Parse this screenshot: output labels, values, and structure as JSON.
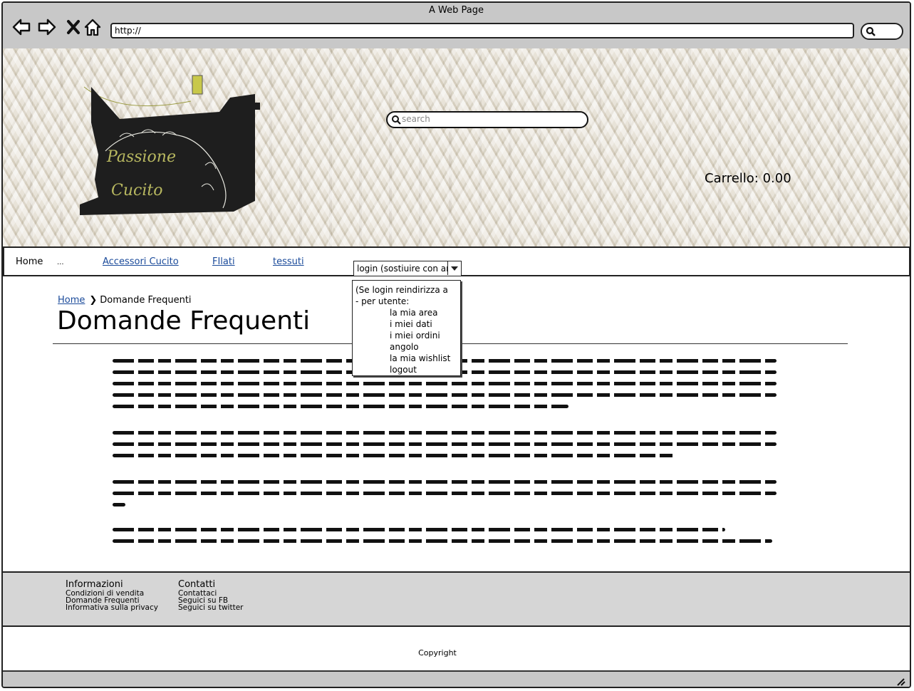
{
  "window": {
    "title": "A Web Page",
    "url": "http://"
  },
  "header": {
    "search_placeholder": "search",
    "cart_label": "Carrello: 0.00",
    "logo_text_1": "Passione",
    "logo_text_2": "Cucito"
  },
  "nav": {
    "home": "Home",
    "ellipsis": "...",
    "links": [
      "Accessori Cucito",
      "FIlati",
      "tessuti"
    ],
    "login_select": "login (sostiuire con area"
  },
  "dropdown": {
    "items": [
      "(Se login reindirizza a",
      "- per utente:",
      "la mia area",
      "i miei dati",
      "i miei ordini",
      "angolo",
      "la mia wishlist",
      "logout"
    ]
  },
  "breadcrumb": {
    "home": "Home",
    "current": "Domande Frequenti"
  },
  "page": {
    "title": "Domande Frequenti"
  },
  "footer": {
    "info": {
      "heading": "Informazioni",
      "links": [
        "Condizioni di vendita",
        "Domande Frequenti",
        "Informativa sulla privacy"
      ]
    },
    "contacts": {
      "heading": "Contatti",
      "links": [
        "Contattaci",
        "Seguici su FB",
        "Seguici su twitter"
      ]
    },
    "copyright": "Copyright"
  },
  "colors": {
    "chrome": "#c8c8c8",
    "link": "#1a4a9a",
    "footer": "#d6d6d6"
  }
}
